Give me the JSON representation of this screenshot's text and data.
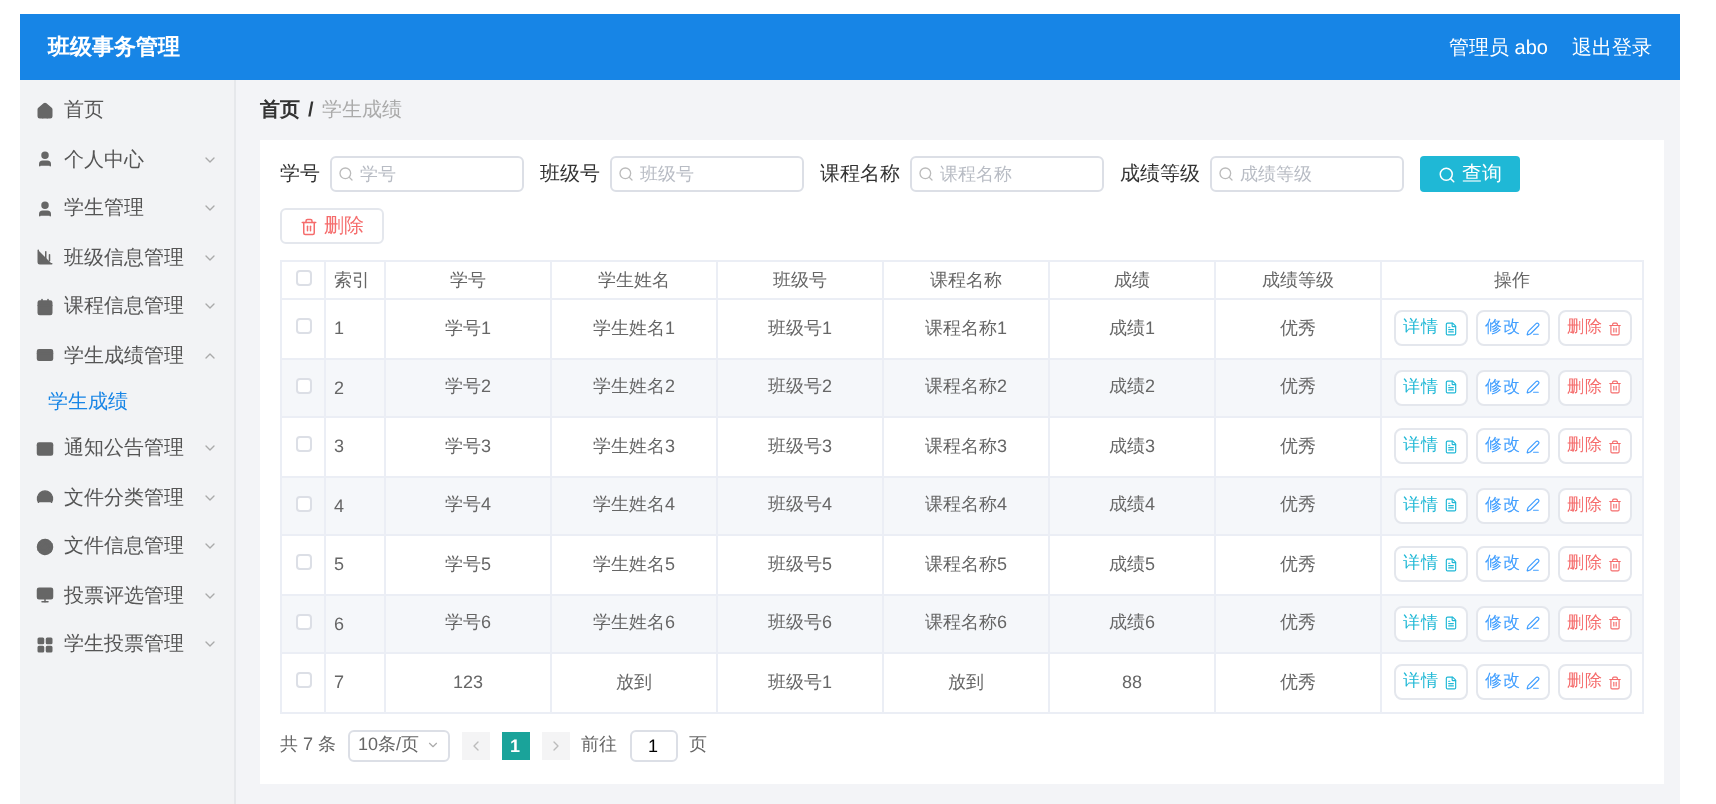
{
  "header": {
    "title": "班级事务管理",
    "user": "管理员 abo",
    "logout": "退出登录"
  },
  "sidebar": {
    "items": [
      {
        "label": "首页",
        "kind": "link"
      },
      {
        "label": "个人中心",
        "kind": "menu",
        "expanded": false
      },
      {
        "label": "学生管理",
        "kind": "menu",
        "expanded": false
      },
      {
        "label": "班级信息管理",
        "kind": "menu",
        "expanded": false
      },
      {
        "label": "课程信息管理",
        "kind": "menu",
        "expanded": false
      },
      {
        "label": "学生成绩管理",
        "kind": "menu",
        "expanded": true,
        "children": [
          {
            "label": "学生成绩",
            "selected": true
          }
        ]
      },
      {
        "label": "通知公告管理",
        "kind": "menu",
        "expanded": false
      },
      {
        "label": "文件分类管理",
        "kind": "menu",
        "expanded": false
      },
      {
        "label": "文件信息管理",
        "kind": "menu",
        "expanded": false
      },
      {
        "label": "投票评选管理",
        "kind": "menu",
        "expanded": false
      },
      {
        "label": "学生投票管理",
        "kind": "menu",
        "expanded": false
      }
    ]
  },
  "breadcrumb": {
    "items": [
      "首页",
      "学生成绩"
    ],
    "separator": "/"
  },
  "search": {
    "fields": [
      {
        "label": "学号",
        "placeholder": "学号"
      },
      {
        "label": "班级号",
        "placeholder": "班级号"
      },
      {
        "label": "课程名称",
        "placeholder": "课程名称"
      },
      {
        "label": "成绩等级",
        "placeholder": "成绩等级"
      }
    ],
    "button": "查询"
  },
  "delete_button": "删除",
  "table": {
    "columns": [
      "索引",
      "学号",
      "学生姓名",
      "班级号",
      "课程名称",
      "成绩",
      "成绩等级",
      "操作"
    ],
    "rows": [
      {
        "checked": false,
        "actions": [
          {
            "label": "详情",
            "kind": "detail"
          },
          {
            "label": "修改",
            "kind": "edit"
          },
          {
            "label": "删除",
            "kind": "delete"
          }
        ],
        "cells": [
          "1",
          "学号1",
          "学生姓名1",
          "班级号1",
          "课程名称1",
          "成绩1",
          "优秀"
        ]
      },
      {
        "checked": false,
        "actions": [
          {
            "label": "详情",
            "kind": "detail"
          },
          {
            "label": "修改",
            "kind": "edit"
          },
          {
            "label": "删除",
            "kind": "delete"
          }
        ],
        "cells": [
          "2",
          "学号2",
          "学生姓名2",
          "班级号2",
          "课程名称2",
          "成绩2",
          "优秀"
        ]
      },
      {
        "checked": false,
        "actions": [
          {
            "label": "详情",
            "kind": "detail"
          },
          {
            "label": "修改",
            "kind": "edit"
          },
          {
            "label": "删除",
            "kind": "delete"
          }
        ],
        "cells": [
          "3",
          "学号3",
          "学生姓名3",
          "班级号3",
          "课程名称3",
          "成绩3",
          "优秀"
        ]
      },
      {
        "checked": false,
        "actions": [
          {
            "label": "详情",
            "kind": "detail"
          },
          {
            "label": "修改",
            "kind": "edit"
          },
          {
            "label": "删除",
            "kind": "delete"
          }
        ],
        "cells": [
          "4",
          "学号4",
          "学生姓名4",
          "班级号4",
          "课程名称4",
          "成绩4",
          "优秀"
        ]
      },
      {
        "checked": false,
        "actions": [
          {
            "label": "详情",
            "kind": "detail"
          },
          {
            "label": "修改",
            "kind": "edit"
          },
          {
            "label": "删除",
            "kind": "delete"
          }
        ],
        "cells": [
          "5",
          "学号5",
          "学生姓名5",
          "班级号5",
          "课程名称5",
          "成绩5",
          "优秀"
        ]
      },
      {
        "checked": false,
        "actions": [
          {
            "label": "详情",
            "kind": "detail"
          },
          {
            "label": "修改",
            "kind": "edit"
          },
          {
            "label": "删除",
            "kind": "delete"
          }
        ],
        "cells": [
          "6",
          "学号6",
          "学生姓名6",
          "班级号6",
          "课程名称6",
          "成绩6",
          "优秀"
        ]
      },
      {
        "checked": false,
        "actions": [
          {
            "label": "详情",
            "kind": "detail"
          },
          {
            "label": "修改",
            "kind": "edit"
          },
          {
            "label": "删除",
            "kind": "delete"
          }
        ],
        "cells": [
          "7",
          "123",
          "放到",
          "班级号1",
          "放到",
          "88",
          "优秀"
        ]
      }
    ],
    "header_checked": false
  },
  "pagination": {
    "total": "共 7 条",
    "page_size": "10条/页",
    "pages": [
      {
        "label": "1",
        "selected": true
      }
    ],
    "goto_label": "前往",
    "goto_value": "1",
    "goto_suffix": "页"
  }
}
